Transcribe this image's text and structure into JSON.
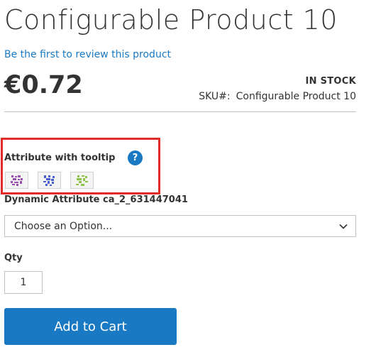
{
  "product": {
    "title": "Configurable Product 10",
    "review_link": "Be the first to review this product",
    "price": "€0.72",
    "stock": "IN STOCK",
    "sku_label": "SKU#:",
    "sku_value": "Configurable Product 10"
  },
  "attributes": {
    "tooltip_attr_label": "Attribute with tooltip",
    "help_icon_glyph": "?",
    "swatches": [
      {
        "icon": "purple-swatch-pattern",
        "color": "#9b4fb0"
      },
      {
        "icon": "blue-swatch-pattern",
        "color": "#4a5fc9"
      },
      {
        "icon": "green-swatch-pattern",
        "color": "#8fc24a"
      }
    ],
    "dynamic_attr_label": "Dynamic Attribute ca_2_631447041",
    "select_placeholder": "Choose an Option..."
  },
  "qty": {
    "label": "Qty",
    "value": "1"
  },
  "cart": {
    "button_label": "Add to Cart"
  },
  "colors": {
    "accent": "#1979c3",
    "highlight_border": "#e02b27",
    "text": "#333333"
  }
}
